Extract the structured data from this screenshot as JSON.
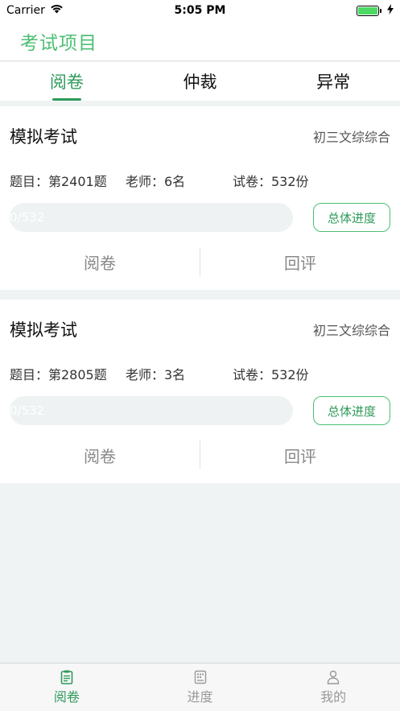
{
  "status_bar": {
    "carrier": "Carrier",
    "time": "5:05 PM"
  },
  "header": {
    "title": "考试项目"
  },
  "tabs": [
    {
      "label": "阅卷",
      "active": true
    },
    {
      "label": "仲裁",
      "active": false
    },
    {
      "label": "异常",
      "active": false
    }
  ],
  "cards": [
    {
      "title": "模拟考试",
      "subject": "初三文综综合",
      "question": "题目：第2401题",
      "teachers": "老师：6名",
      "papers": "试卷：532份",
      "progress_text": "0/532",
      "progress_fraction": 0.0,
      "overall_button": "总体进度",
      "action_mark": "阅卷",
      "action_review": "回评"
    },
    {
      "title": "模拟考试",
      "subject": "初三文综综合",
      "question": "题目：第2805题",
      "teachers": "老师：3名",
      "papers": "试卷：532份",
      "progress_text": "0/532",
      "progress_fraction": 0.0,
      "overall_button": "总体进度",
      "action_mark": "阅卷",
      "action_review": "回评"
    }
  ],
  "tabbar": [
    {
      "label": "阅卷",
      "icon": "clipboard-icon",
      "active": true
    },
    {
      "label": "进度",
      "icon": "progress-document-icon",
      "active": false
    },
    {
      "label": "我的",
      "icon": "person-icon",
      "active": false
    }
  ],
  "colors": {
    "accent": "#4cbf73",
    "accent_dark": "#2f9a5a",
    "background": "#eff3f4"
  }
}
